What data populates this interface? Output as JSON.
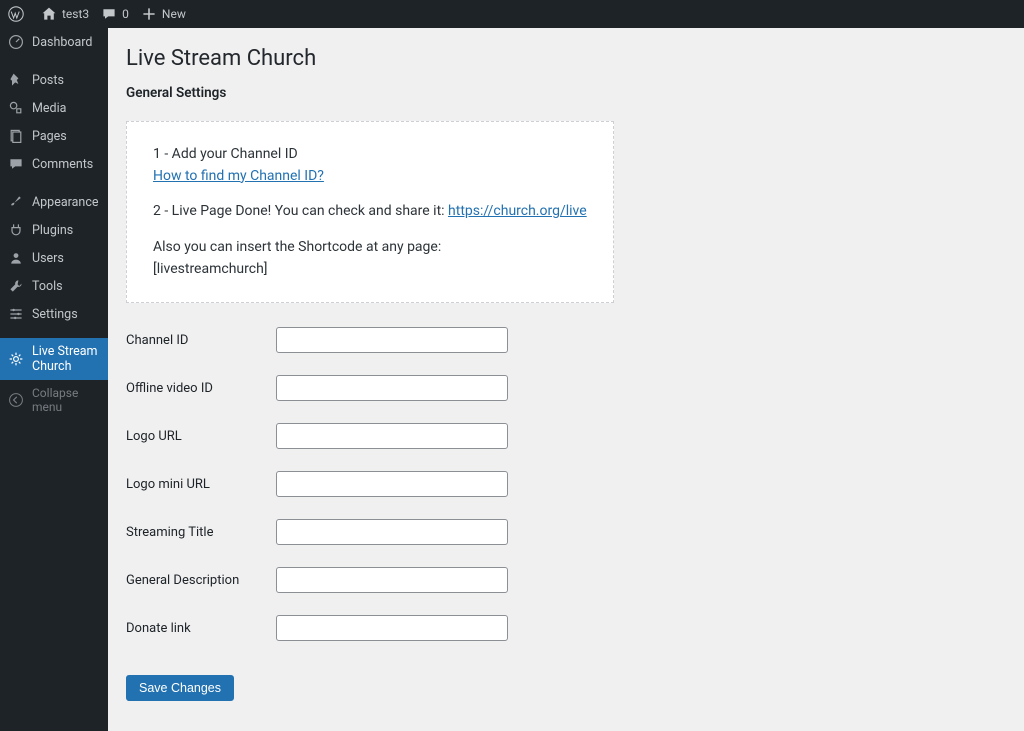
{
  "adminbar": {
    "site_name": "test3",
    "comments_count": "0",
    "new_label": "New"
  },
  "sidebar": {
    "items": [
      {
        "label": "Dashboard"
      },
      {
        "label": "Posts"
      },
      {
        "label": "Media"
      },
      {
        "label": "Pages"
      },
      {
        "label": "Comments"
      },
      {
        "label": "Appearance"
      },
      {
        "label": "Plugins"
      },
      {
        "label": "Users"
      },
      {
        "label": "Tools"
      },
      {
        "label": "Settings"
      },
      {
        "label": "Live Stream Church"
      }
    ],
    "collapse_label": "Collapse menu"
  },
  "page": {
    "title": "Live Stream Church",
    "section_title": "General Settings"
  },
  "instructions": {
    "step1": "1 - Add your Channel ID",
    "step1_link_text": "How to find my Channel ID?",
    "step2_prefix": "2 - Live Page Done! You can check and share it: ",
    "step2_link_text": "https://church.org/live",
    "shortcode_intro": "Also you can insert the Shortcode at any page:",
    "shortcode": "[livestreamchurch]"
  },
  "form": {
    "fields": [
      {
        "label": "Channel ID",
        "value": ""
      },
      {
        "label": "Offline video ID",
        "value": ""
      },
      {
        "label": "Logo URL",
        "value": ""
      },
      {
        "label": "Logo mini URL",
        "value": ""
      },
      {
        "label": "Streaming Title",
        "value": ""
      },
      {
        "label": "General Description",
        "value": ""
      },
      {
        "label": "Donate link",
        "value": ""
      }
    ],
    "submit_label": "Save Changes"
  }
}
